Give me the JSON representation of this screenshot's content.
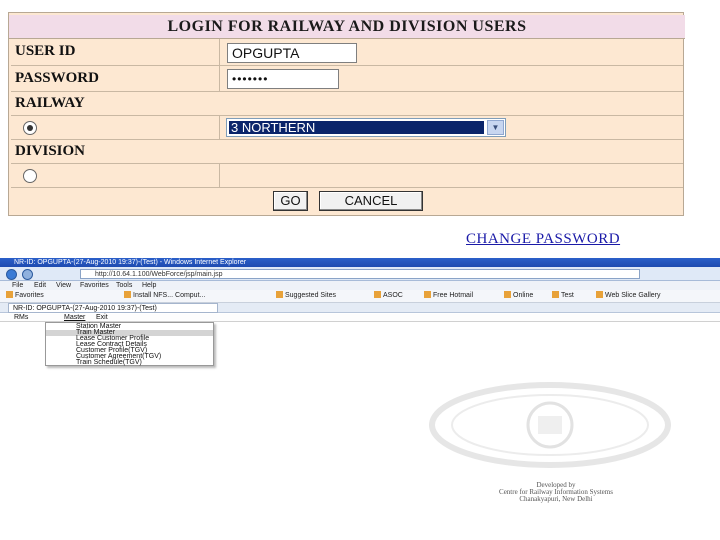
{
  "login": {
    "title": "LOGIN FOR RAILWAY AND DIVISION USERS",
    "user_id_label": "USER ID",
    "user_id_value": "OPGUPTA",
    "password_label": "PASSWORD",
    "password_value": "•••••••",
    "railway_label": "RAILWAY",
    "railway_selected": "3 NORTHERN",
    "division_label": "DIVISION",
    "go_label": "GO",
    "cancel_label": "CANCEL",
    "change_password_label": "CHANGE PASSWORD"
  },
  "ie": {
    "window_title": "NR-ID: OPGUPTA-(27-Aug-2010 19:37)-(Test) - Windows Internet Explorer",
    "url": "http://10.64.1.100/WebForce/jsp/main.jsp",
    "menus": [
      "File",
      "Edit",
      "View",
      "Favorites",
      "Tools",
      "Help"
    ],
    "favorites_label": "Favorites",
    "favorites": [
      "Install NFS... Comput...",
      "Suggested Sites",
      "ASOC",
      "Free Hotmail",
      "Online",
      "Test",
      "Web Slice Gallery"
    ],
    "tab_label": "NR-ID: OPGUPTA-(27-Aug-2010 19:37)-(Test)"
  },
  "app": {
    "menus": [
      "RMs",
      "Master",
      "Exit"
    ],
    "dropdown_items": [
      "Station Master",
      "Train Master",
      "Lease Customer Profile",
      "Lease Contract Details",
      "Customer Profile(TGV)",
      "Customer Agreement(TGV)",
      "Train Schedule(TGV)"
    ],
    "credits": [
      "Developed by",
      "Centre for Railway Information Systems",
      "Chanakyapuri, New Delhi"
    ]
  }
}
